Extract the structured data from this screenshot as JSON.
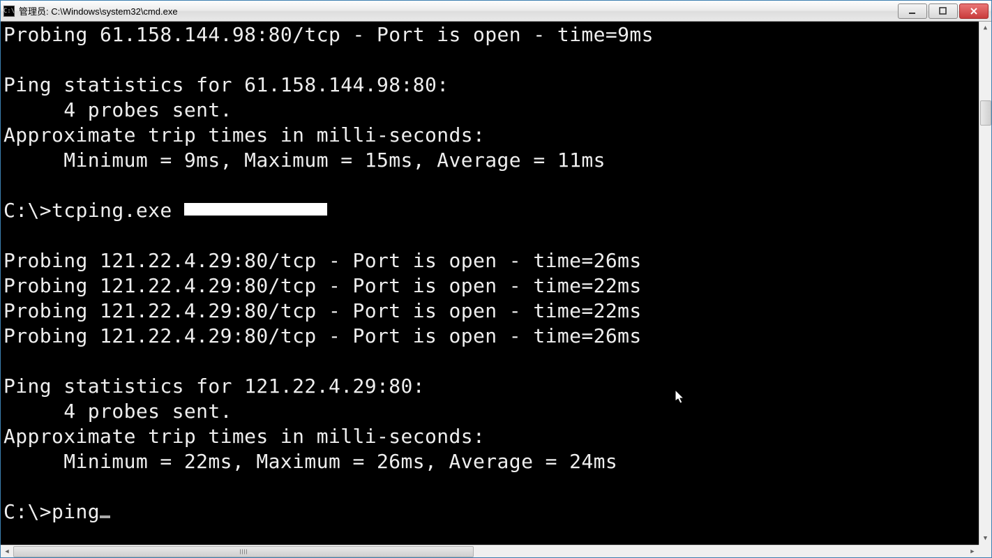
{
  "window": {
    "title": "管理员: C:\\Windows\\system32\\cmd.exe"
  },
  "terminal": {
    "lines": [
      "Probing 61.158.144.98:80/tcp - Port is open - time=9ms",
      "",
      "Ping statistics for 61.158.144.98:80:",
      "     4 probes sent.",
      "Approximate trip times in milli-seconds:",
      "     Minimum = 9ms, Maximum = 15ms, Average = 11ms",
      "",
      "C:\\>tcping.exe ",
      "",
      "Probing 121.22.4.29:80/tcp - Port is open - time=26ms",
      "Probing 121.22.4.29:80/tcp - Port is open - time=22ms",
      "Probing 121.22.4.29:80/tcp - Port is open - time=22ms",
      "Probing 121.22.4.29:80/tcp - Port is open - time=26ms",
      "",
      "Ping statistics for 121.22.4.29:80:",
      "     4 probes sent.",
      "Approximate trip times in milli-seconds:",
      "     Minimum = 22ms, Maximum = 26ms, Average = 24ms",
      "",
      "C:\\>ping"
    ],
    "redacted_line_index": 7,
    "cursor_line_index": 19
  }
}
